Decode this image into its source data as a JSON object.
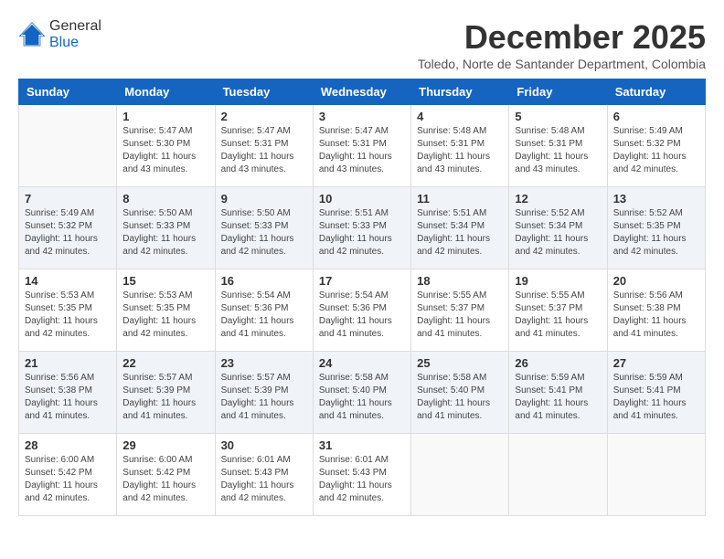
{
  "logo": {
    "general": "General",
    "blue": "Blue"
  },
  "header": {
    "month": "December 2025",
    "location": "Toledo, Norte de Santander Department, Colombia"
  },
  "weekdays": [
    "Sunday",
    "Monday",
    "Tuesday",
    "Wednesday",
    "Thursday",
    "Friday",
    "Saturday"
  ],
  "weeks": [
    [
      {
        "day": "",
        "sunrise": "",
        "sunset": "",
        "daylight": ""
      },
      {
        "day": "1",
        "sunrise": "5:47 AM",
        "sunset": "5:30 PM",
        "daylight": "11 hours and 43 minutes."
      },
      {
        "day": "2",
        "sunrise": "5:47 AM",
        "sunset": "5:31 PM",
        "daylight": "11 hours and 43 minutes."
      },
      {
        "day": "3",
        "sunrise": "5:47 AM",
        "sunset": "5:31 PM",
        "daylight": "11 hours and 43 minutes."
      },
      {
        "day": "4",
        "sunrise": "5:48 AM",
        "sunset": "5:31 PM",
        "daylight": "11 hours and 43 minutes."
      },
      {
        "day": "5",
        "sunrise": "5:48 AM",
        "sunset": "5:31 PM",
        "daylight": "11 hours and 43 minutes."
      },
      {
        "day": "6",
        "sunrise": "5:49 AM",
        "sunset": "5:32 PM",
        "daylight": "11 hours and 42 minutes."
      }
    ],
    [
      {
        "day": "7",
        "sunrise": "5:49 AM",
        "sunset": "5:32 PM",
        "daylight": "11 hours and 42 minutes."
      },
      {
        "day": "8",
        "sunrise": "5:50 AM",
        "sunset": "5:33 PM",
        "daylight": "11 hours and 42 minutes."
      },
      {
        "day": "9",
        "sunrise": "5:50 AM",
        "sunset": "5:33 PM",
        "daylight": "11 hours and 42 minutes."
      },
      {
        "day": "10",
        "sunrise": "5:51 AM",
        "sunset": "5:33 PM",
        "daylight": "11 hours and 42 minutes."
      },
      {
        "day": "11",
        "sunrise": "5:51 AM",
        "sunset": "5:34 PM",
        "daylight": "11 hours and 42 minutes."
      },
      {
        "day": "12",
        "sunrise": "5:52 AM",
        "sunset": "5:34 PM",
        "daylight": "11 hours and 42 minutes."
      },
      {
        "day": "13",
        "sunrise": "5:52 AM",
        "sunset": "5:35 PM",
        "daylight": "11 hours and 42 minutes."
      }
    ],
    [
      {
        "day": "14",
        "sunrise": "5:53 AM",
        "sunset": "5:35 PM",
        "daylight": "11 hours and 42 minutes."
      },
      {
        "day": "15",
        "sunrise": "5:53 AM",
        "sunset": "5:35 PM",
        "daylight": "11 hours and 42 minutes."
      },
      {
        "day": "16",
        "sunrise": "5:54 AM",
        "sunset": "5:36 PM",
        "daylight": "11 hours and 41 minutes."
      },
      {
        "day": "17",
        "sunrise": "5:54 AM",
        "sunset": "5:36 PM",
        "daylight": "11 hours and 41 minutes."
      },
      {
        "day": "18",
        "sunrise": "5:55 AM",
        "sunset": "5:37 PM",
        "daylight": "11 hours and 41 minutes."
      },
      {
        "day": "19",
        "sunrise": "5:55 AM",
        "sunset": "5:37 PM",
        "daylight": "11 hours and 41 minutes."
      },
      {
        "day": "20",
        "sunrise": "5:56 AM",
        "sunset": "5:38 PM",
        "daylight": "11 hours and 41 minutes."
      }
    ],
    [
      {
        "day": "21",
        "sunrise": "5:56 AM",
        "sunset": "5:38 PM",
        "daylight": "11 hours and 41 minutes."
      },
      {
        "day": "22",
        "sunrise": "5:57 AM",
        "sunset": "5:39 PM",
        "daylight": "11 hours and 41 minutes."
      },
      {
        "day": "23",
        "sunrise": "5:57 AM",
        "sunset": "5:39 PM",
        "daylight": "11 hours and 41 minutes."
      },
      {
        "day": "24",
        "sunrise": "5:58 AM",
        "sunset": "5:40 PM",
        "daylight": "11 hours and 41 minutes."
      },
      {
        "day": "25",
        "sunrise": "5:58 AM",
        "sunset": "5:40 PM",
        "daylight": "11 hours and 41 minutes."
      },
      {
        "day": "26",
        "sunrise": "5:59 AM",
        "sunset": "5:41 PM",
        "daylight": "11 hours and 41 minutes."
      },
      {
        "day": "27",
        "sunrise": "5:59 AM",
        "sunset": "5:41 PM",
        "daylight": "11 hours and 41 minutes."
      }
    ],
    [
      {
        "day": "28",
        "sunrise": "6:00 AM",
        "sunset": "5:42 PM",
        "daylight": "11 hours and 42 minutes."
      },
      {
        "day": "29",
        "sunrise": "6:00 AM",
        "sunset": "5:42 PM",
        "daylight": "11 hours and 42 minutes."
      },
      {
        "day": "30",
        "sunrise": "6:01 AM",
        "sunset": "5:43 PM",
        "daylight": "11 hours and 42 minutes."
      },
      {
        "day": "31",
        "sunrise": "6:01 AM",
        "sunset": "5:43 PM",
        "daylight": "11 hours and 42 minutes."
      },
      {
        "day": "",
        "sunrise": "",
        "sunset": "",
        "daylight": ""
      },
      {
        "day": "",
        "sunrise": "",
        "sunset": "",
        "daylight": ""
      },
      {
        "day": "",
        "sunrise": "",
        "sunset": "",
        "daylight": ""
      }
    ]
  ],
  "labels": {
    "sunrise": "Sunrise:",
    "sunset": "Sunset:",
    "daylight": "Daylight:"
  }
}
